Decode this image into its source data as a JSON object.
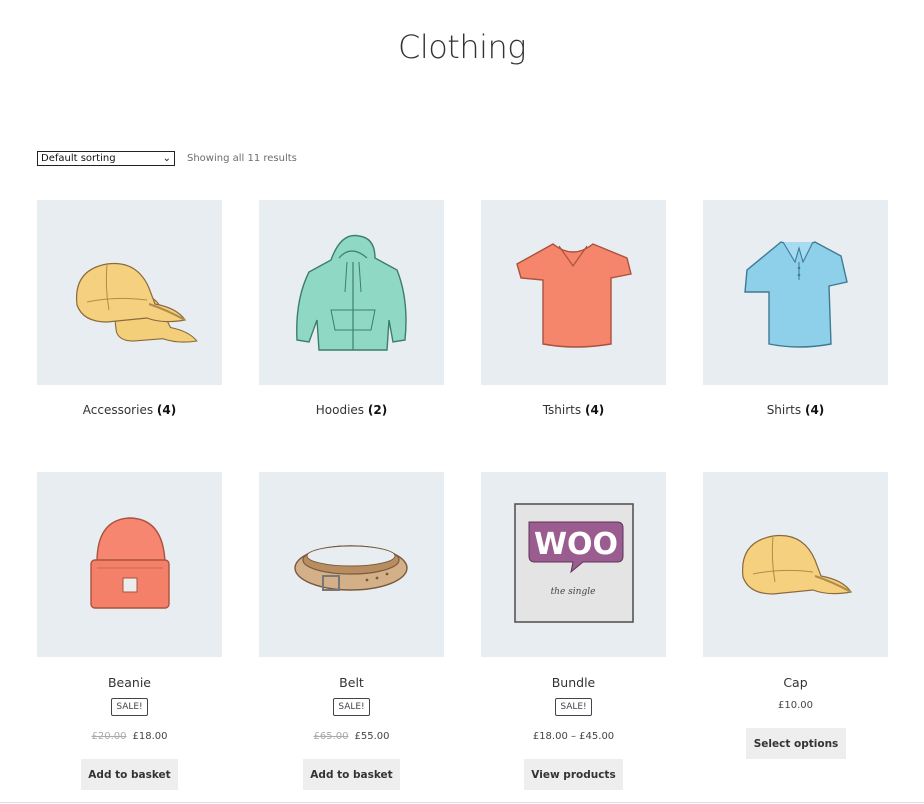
{
  "page": {
    "title": "Clothing"
  },
  "toolbar": {
    "sort_selected": "Default sorting",
    "result_count": "Showing all 11 results"
  },
  "categories": [
    {
      "name": "Accessories",
      "count": "(4)",
      "icon": "cap-icon"
    },
    {
      "name": "Hoodies",
      "count": "(2)",
      "icon": "hoodie-icon"
    },
    {
      "name": "Tshirts",
      "count": "(4)",
      "icon": "tshirt-icon"
    },
    {
      "name": "Shirts",
      "count": "(4)",
      "icon": "polo-shirt-icon"
    }
  ],
  "products": [
    {
      "name": "Beanie",
      "sale_badge": "Sale!",
      "old_price": "£20.00",
      "price": "£18.00",
      "button": "Add to basket",
      "icon": "beanie-icon"
    },
    {
      "name": "Belt",
      "sale_badge": "Sale!",
      "old_price": "£65.00",
      "price": "£55.00",
      "button": "Add to basket",
      "icon": "belt-icon"
    },
    {
      "name": "Bundle",
      "sale_badge": "Sale!",
      "price": "£18.00 – £45.00",
      "button": "View products",
      "icon": "woo-poster-icon",
      "poster_text": "WOO",
      "poster_subtext": "the single"
    },
    {
      "name": "Cap",
      "price": "£10.00",
      "button": "Select options",
      "icon": "cap-icon"
    }
  ],
  "colors": {
    "tile_bg": "#e8edf1",
    "button_bg": "#eeeeee",
    "text": "#43454b"
  }
}
